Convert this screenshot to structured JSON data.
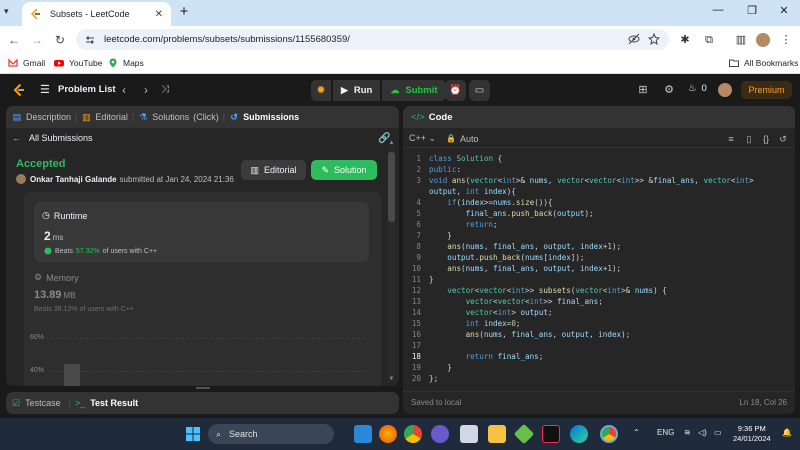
{
  "browser": {
    "tab_title": "Subsets - LeetCode",
    "url": "leetcode.com/problems/subsets/submissions/1155680359/",
    "bookmarks": [
      "Gmail",
      "YouTube",
      "Maps"
    ],
    "all_bookmarks": "All Bookmarks"
  },
  "lc_nav": {
    "problem_list": "Problem List",
    "run": "Run",
    "submit": "Submit",
    "fire_count": "0",
    "premium": "Premium"
  },
  "left_panel": {
    "tabs": [
      {
        "label": "Description"
      },
      {
        "label": "Editorial"
      },
      {
        "label": "Solutions"
      },
      {
        "label": "(Click)"
      },
      {
        "label": "Submissions"
      }
    ],
    "all_submissions": "All Submissions",
    "status": "Accepted",
    "author": "Onkar Tanhaji Galande",
    "submitted_text": "submitted at Jan 24, 2024 21:36",
    "editorial_btn": "Editorial",
    "solution_btn": "Solution",
    "runtime": {
      "label": "Runtime",
      "value": "2",
      "unit": "ms",
      "beats_prefix": "Beats",
      "beats_pct": "57.32%",
      "beats_suffix": "of users with C++"
    },
    "memory": {
      "label": "Memory",
      "value": "13.89",
      "unit": "MB",
      "beats_text": "Beats 38.12% of users with C++"
    },
    "chart_ticks": [
      "60%",
      "40%"
    ],
    "testcase": "Testcase",
    "test_result": "Test Result"
  },
  "code_panel": {
    "title": "Code",
    "language": "C++",
    "mode": "Auto",
    "saved": "Saved to local",
    "cursor": "Ln 18, Col 26",
    "current_line": 18
  },
  "taskbar": {
    "search": "Search",
    "lang": "ENG",
    "time": "9:36 PM",
    "date": "24/01/2024"
  },
  "colors": {
    "accent_green": "#2cbb5d",
    "premium": "#ffa116",
    "bg": "#1a1a1a",
    "panel": "#262626"
  }
}
